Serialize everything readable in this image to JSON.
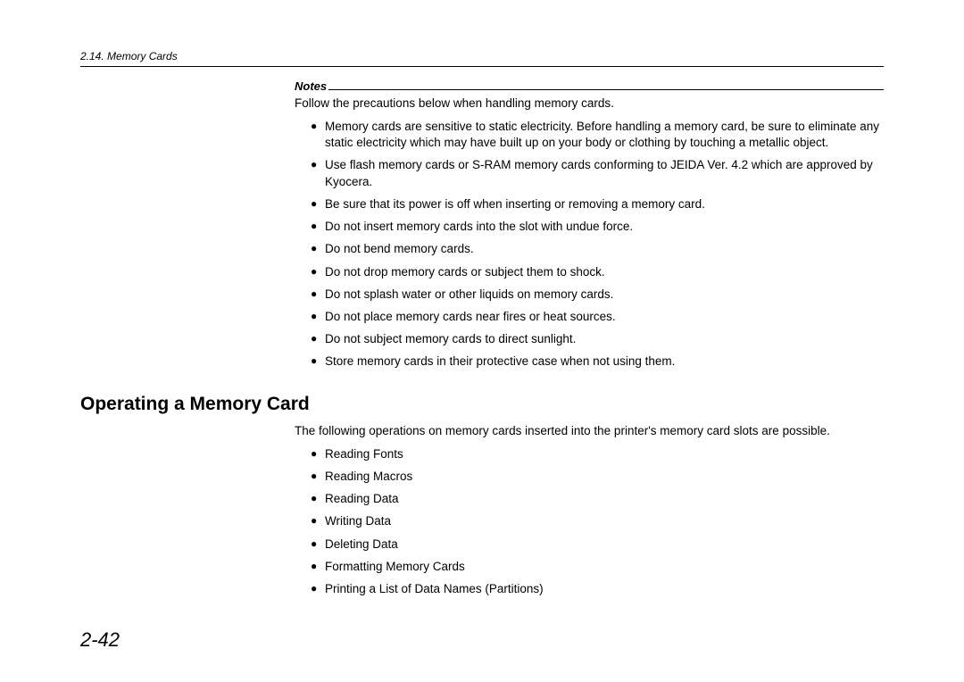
{
  "header": {
    "section": "2.14.  Memory Cards"
  },
  "notes": {
    "label": "Notes",
    "intro": "Follow the precautions below when handling memory cards.",
    "items": [
      "Memory cards are sensitive to static electricity.  Before handling a memory card, be sure to eliminate any static electricity which may have built up on your body or clothing by touching a metallic object.",
      "Use flash memory cards or S-RAM memory cards conforming to JEIDA Ver. 4.2 which are approved by Kyocera.",
      "Be sure that its power is off when inserting or removing a memory card.",
      "Do not insert memory cards into the slot with undue force.",
      "Do not bend memory cards.",
      "Do not drop memory cards or subject them to shock.",
      "Do not splash water or other liquids on memory cards.",
      "Do not place memory cards near fires or heat sources.",
      "Do not subject memory cards to direct sunlight.",
      "Store memory cards in their protective case when not using them."
    ]
  },
  "operating": {
    "heading": "Operating a Memory Card",
    "intro": "The following operations on memory cards inserted into the printer's memory card slots are possible.",
    "items": [
      "Reading Fonts",
      "Reading Macros",
      "Reading Data",
      "Writing Data",
      "Deleting Data",
      "Formatting Memory Cards",
      "Printing a List of Data Names (Partitions)"
    ]
  },
  "page_number": "2-42"
}
